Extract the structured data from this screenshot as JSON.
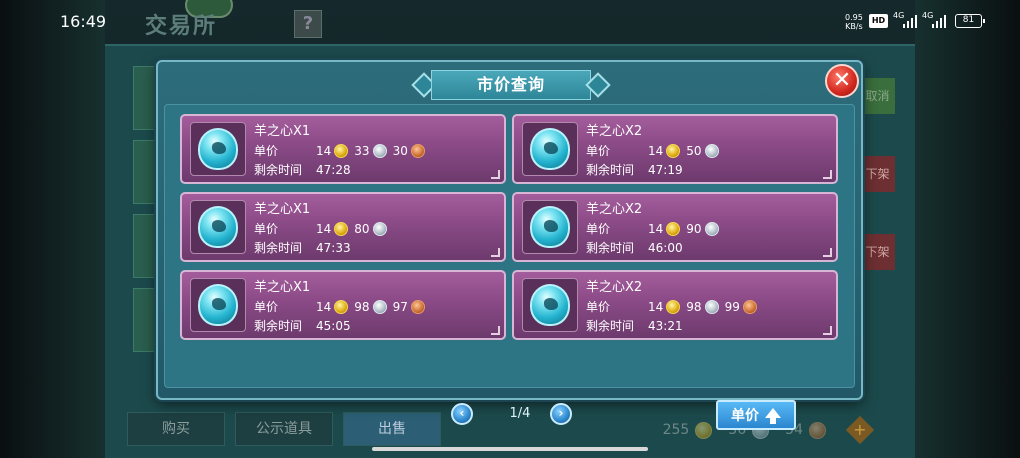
{
  "status_bar": {
    "time": "16:49",
    "net_speed_value": "0.95",
    "net_speed_unit": "KB/s",
    "hd_label": "HD",
    "sim1_label": "4G",
    "sim2_label": "4G",
    "battery": "81"
  },
  "background": {
    "title": "交易所",
    "help": "?",
    "side_buttons": [
      "取消",
      "下架",
      "下架"
    ],
    "tabs": [
      "购买",
      "公示道具",
      "出售"
    ],
    "currency": {
      "gold": "255",
      "silver": "56",
      "copper": "54"
    }
  },
  "dialog": {
    "title": "市价查询",
    "close": "✕",
    "labels": {
      "price": "单价",
      "time_left": "剩余时间"
    },
    "listings": [
      {
        "name": "羊之心X1",
        "gold": "14",
        "silver": "33",
        "copper": "30",
        "time": "47:28"
      },
      {
        "name": "羊之心X2",
        "gold": "14",
        "silver": "50",
        "copper": "",
        "time": "47:19"
      },
      {
        "name": "羊之心X1",
        "gold": "14",
        "silver": "80",
        "copper": "",
        "time": "47:33"
      },
      {
        "name": "羊之心X2",
        "gold": "14",
        "silver": "90",
        "copper": "",
        "time": "46:00"
      },
      {
        "name": "羊之心X1",
        "gold": "14",
        "silver": "98",
        "copper": "97",
        "time": "45:05"
      },
      {
        "name": "羊之心X2",
        "gold": "14",
        "silver": "98",
        "copper": "99",
        "time": "43:21"
      }
    ],
    "pagination": {
      "prev": "‹",
      "next": "›",
      "page": "1/4"
    },
    "sort_button": "单价"
  }
}
